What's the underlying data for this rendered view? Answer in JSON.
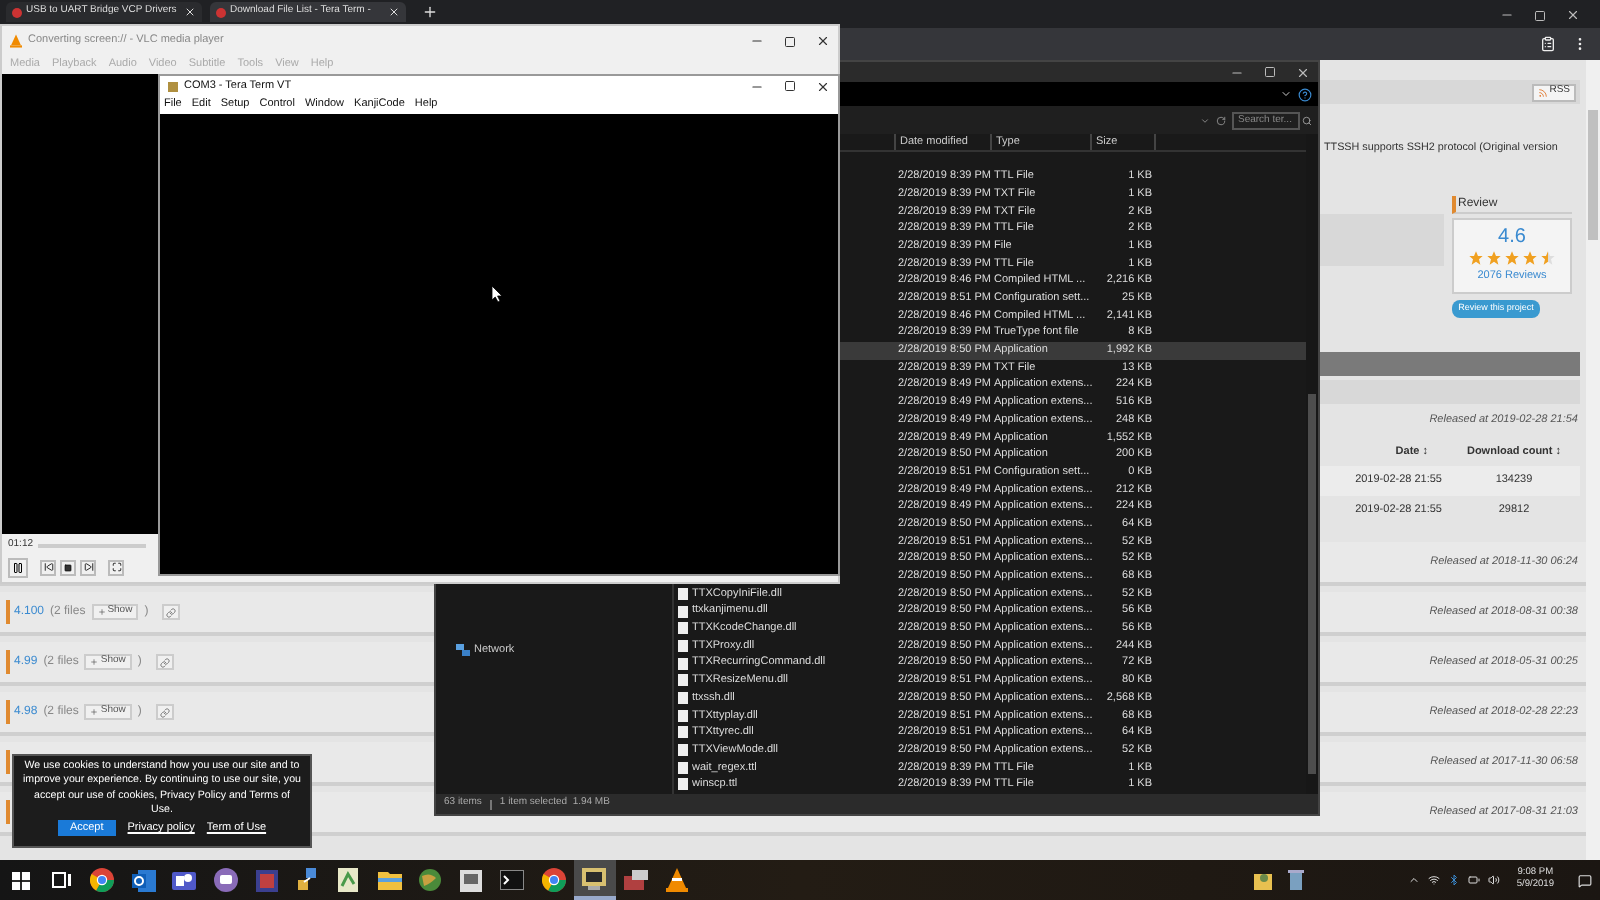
{
  "browser": {
    "tabs": [
      {
        "title": "USB to UART Bridge VCP Drivers",
        "selected": false
      },
      {
        "title": "Download File List - Tera Term -",
        "selected": true
      }
    ]
  },
  "page": {
    "rss": "RSS",
    "description": "TTSSH supports SSH2 protocol (Original version",
    "review": {
      "heading": "Review",
      "rating": "4.6",
      "stars": 4.5,
      "count": "2076 Reviews",
      "button": "Review this project"
    },
    "latest": {
      "released": "Released at 2019-02-28 21:54",
      "columns": [
        "Date ↕",
        "Download count ↕"
      ],
      "rows": [
        {
          "date": "2019-02-28 21:55",
          "count": "134239"
        },
        {
          "date": "2019-02-28 21:55",
          "count": "29812"
        }
      ]
    },
    "releases": [
      {
        "released": "Released at 2018-11-30 06:24"
      },
      {
        "version": "4.100",
        "files": "(2 files",
        "show": "Show",
        "paren": ")",
        "released": "Released at 2018-08-31 00:38"
      },
      {
        "version": "4.99",
        "files": "(2 files",
        "show": "Show",
        "paren": ")",
        "released": "Released at 2018-05-31 00:25"
      },
      {
        "version": "4.98",
        "files": "(2 files",
        "show": "Show",
        "paren": ")",
        "released": "Released at 2018-02-28 22:23"
      },
      {
        "released": "Released at 2017-11-30 06:58"
      },
      {
        "released": "Released at 2017-08-31 21:03"
      }
    ]
  },
  "vlc": {
    "title": "Converting screen:// - VLC media player",
    "menu": [
      "Media",
      "Playback",
      "Audio",
      "Video",
      "Subtitle",
      "Tools",
      "View",
      "Help"
    ],
    "time": "01:12"
  },
  "teraterm": {
    "title": "COM3 - Tera Term VT",
    "menu": [
      "File",
      "Edit",
      "Setup",
      "Control",
      "Window",
      "KanjiCode",
      "Help"
    ]
  },
  "explorer": {
    "search": {
      "placeholder": "Search ter..."
    },
    "columns": [
      "Date modified",
      "Type",
      "Size"
    ],
    "nav": "Network",
    "rows": [
      {
        "date": "2/28/2019 8:39 PM",
        "type": "TTL File",
        "size": "1 KB",
        "selected": false
      },
      {
        "date": "2/28/2019 8:39 PM",
        "type": "TXT File",
        "size": "1 KB",
        "selected": false
      },
      {
        "date": "2/28/2019 8:39 PM",
        "type": "TXT File",
        "size": "2 KB",
        "selected": false
      },
      {
        "date": "2/28/2019 8:39 PM",
        "type": "TTL File",
        "size": "2 KB",
        "selected": false
      },
      {
        "date": "2/28/2019 8:39 PM",
        "type": "File",
        "size": "1 KB",
        "selected": false
      },
      {
        "date": "2/28/2019 8:39 PM",
        "type": "TTL File",
        "size": "1 KB",
        "selected": false
      },
      {
        "date": "2/28/2019 8:46 PM",
        "type": "Compiled HTML ...",
        "size": "2,216 KB",
        "selected": false
      },
      {
        "date": "2/28/2019 8:51 PM",
        "type": "Configuration sett...",
        "size": "25 KB",
        "selected": false
      },
      {
        "date": "2/28/2019 8:46 PM",
        "type": "Compiled HTML ...",
        "size": "2,141 KB",
        "selected": false
      },
      {
        "date": "2/28/2019 8:39 PM",
        "type": "TrueType font file",
        "size": "8 KB",
        "selected": false
      },
      {
        "date": "2/28/2019 8:50 PM",
        "type": "Application",
        "size": "1,992 KB",
        "selected": true
      },
      {
        "date": "2/28/2019 8:39 PM",
        "type": "TXT File",
        "size": "13 KB",
        "selected": false
      },
      {
        "date": "2/28/2019 8:49 PM",
        "type": "Application extens...",
        "size": "224 KB",
        "selected": false
      },
      {
        "date": "2/28/2019 8:49 PM",
        "type": "Application extens...",
        "size": "516 KB",
        "selected": false
      },
      {
        "date": "2/28/2019 8:49 PM",
        "type": "Application extens...",
        "size": "248 KB",
        "selected": false
      },
      {
        "date": "2/28/2019 8:49 PM",
        "type": "Application",
        "size": "1,552 KB",
        "selected": false
      },
      {
        "date": "2/28/2019 8:50 PM",
        "type": "Application",
        "size": "200 KB",
        "selected": false
      },
      {
        "date": "2/28/2019 8:51 PM",
        "type": "Configuration sett...",
        "size": "0 KB",
        "selected": false
      },
      {
        "date": "2/28/2019 8:49 PM",
        "type": "Application extens...",
        "size": "212 KB",
        "selected": false
      },
      {
        "date": "2/28/2019 8:49 PM",
        "type": "Application extens...",
        "size": "224 KB",
        "selected": false
      },
      {
        "date": "2/28/2019 8:50 PM",
        "type": "Application extens...",
        "size": "64 KB",
        "selected": false
      },
      {
        "date": "2/28/2019 8:51 PM",
        "type": "Application extens...",
        "size": "52 KB",
        "selected": false
      },
      {
        "date": "2/28/2019 8:50 PM",
        "type": "Application extens...",
        "size": "52 KB",
        "selected": false
      },
      {
        "date": "2/28/2019 8:50 PM",
        "type": "Application extens...",
        "size": "68 KB",
        "selected": false
      },
      {
        "name": "TTXCopyIniFile.dll",
        "date": "2/28/2019 8:50 PM",
        "type": "Application extens...",
        "size": "52 KB",
        "selected": false
      },
      {
        "name": "ttxkanjimenu.dll",
        "date": "2/28/2019 8:50 PM",
        "type": "Application extens...",
        "size": "56 KB",
        "selected": false
      },
      {
        "name": "TTXKcodeChange.dll",
        "date": "2/28/2019 8:50 PM",
        "type": "Application extens...",
        "size": "56 KB",
        "selected": false
      },
      {
        "name": "TTXProxy.dll",
        "date": "2/28/2019 8:50 PM",
        "type": "Application extens...",
        "size": "244 KB",
        "selected": false
      },
      {
        "name": "TTXRecurringCommand.dll",
        "date": "2/28/2019 8:50 PM",
        "type": "Application extens...",
        "size": "72 KB",
        "selected": false
      },
      {
        "name": "TTXResizeMenu.dll",
        "date": "2/28/2019 8:51 PM",
        "type": "Application extens...",
        "size": "80 KB",
        "selected": false
      },
      {
        "name": "ttxssh.dll",
        "date": "2/28/2019 8:50 PM",
        "type": "Application extens...",
        "size": "2,568 KB",
        "selected": false
      },
      {
        "name": "TTXttyplay.dll",
        "date": "2/28/2019 8:51 PM",
        "type": "Application extens...",
        "size": "68 KB",
        "selected": false
      },
      {
        "name": "TTXttyrec.dll",
        "date": "2/28/2019 8:51 PM",
        "type": "Application extens...",
        "size": "64 KB",
        "selected": false
      },
      {
        "name": "TTXViewMode.dll",
        "date": "2/28/2019 8:50 PM",
        "type": "Application extens...",
        "size": "52 KB",
        "selected": false
      },
      {
        "name": "wait_regex.ttl",
        "date": "2/28/2019 8:39 PM",
        "type": "TTL File",
        "size": "1 KB",
        "selected": false
      },
      {
        "name": "winscp.ttl",
        "date": "2/28/2019 8:39 PM",
        "type": "TTL File",
        "size": "1 KB",
        "selected": false
      }
    ],
    "status": {
      "items": "63 items",
      "selection": "1 item selected  1.94 MB"
    }
  },
  "cookie": {
    "text": "We use cookies to understand how you use our site and to improve your experience. By continuing to use our site, you accept our use of cookies, Privacy Policy and Terms of Use.",
    "accept": "Accept",
    "links": [
      "Privacy policy",
      "Term of Use"
    ]
  },
  "taskbar": {
    "apps": [
      {
        "kind": "windows",
        "selected": false
      },
      {
        "kind": "taskview",
        "selected": false
      },
      {
        "kind": "chrome",
        "selected": false
      },
      {
        "kind": "mail",
        "selected": false
      },
      {
        "kind": "people",
        "selected": false
      },
      {
        "kind": "chat",
        "selected": false
      },
      {
        "kind": "editor",
        "selected": false
      },
      {
        "kind": "network",
        "selected": false
      },
      {
        "kind": "notes",
        "selected": false
      },
      {
        "kind": "folder",
        "selected": false
      },
      {
        "kind": "globe",
        "selected": false
      },
      {
        "kind": "window",
        "selected": false
      },
      {
        "kind": "terminal",
        "selected": false
      },
      {
        "kind": "chrome",
        "selected": false
      },
      {
        "kind": "teraterm",
        "selected": true
      },
      {
        "kind": "tool",
        "selected": false
      },
      {
        "kind": "vlc",
        "selected": false
      }
    ],
    "time": "9:08 PM",
    "date": "5/9/2019"
  }
}
